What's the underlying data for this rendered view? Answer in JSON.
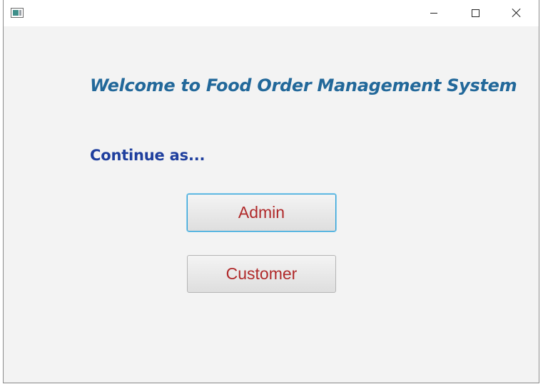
{
  "window": {
    "title": "",
    "controls": {
      "minimize": "minimize-icon",
      "maximize": "maximize-icon",
      "close": "close-icon"
    }
  },
  "main": {
    "welcome_text": "Welcome to Food Order Management System",
    "continue_label": "Continue as...",
    "buttons": {
      "admin": "Admin",
      "customer": "Customer"
    }
  },
  "colors": {
    "welcome": "#22689a",
    "continue": "#1f3f9e",
    "button_text": "#b0292a",
    "focus_border": "#2a9fd6",
    "background": "#f3f3f3"
  }
}
